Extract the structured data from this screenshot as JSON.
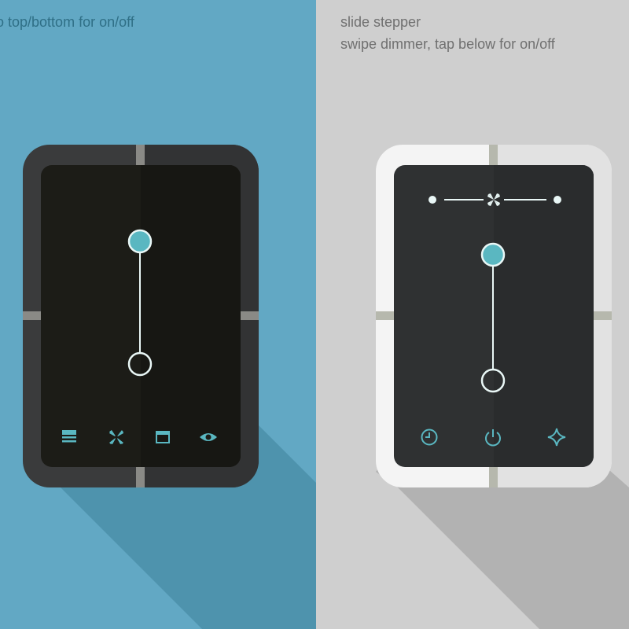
{
  "colors": {
    "left_bg": "#62a8c4",
    "right_bg": "#cfcfcf",
    "accent": "#5ab7c1",
    "line": "#e9f7f6"
  },
  "left": {
    "caption": "o top/bottom for on/off",
    "slider_level": 1,
    "icons": [
      "list-icon",
      "fan-icon",
      "window-icon",
      "eye-icon"
    ]
  },
  "right": {
    "caption_line1": "slide stepper",
    "caption_line2": "swipe dimmer, tap below for on/off",
    "slider_level": 1,
    "stepper_icon": "fan-icon",
    "icons": [
      "clock-icon",
      "power-icon",
      "sparkle-icon"
    ]
  }
}
